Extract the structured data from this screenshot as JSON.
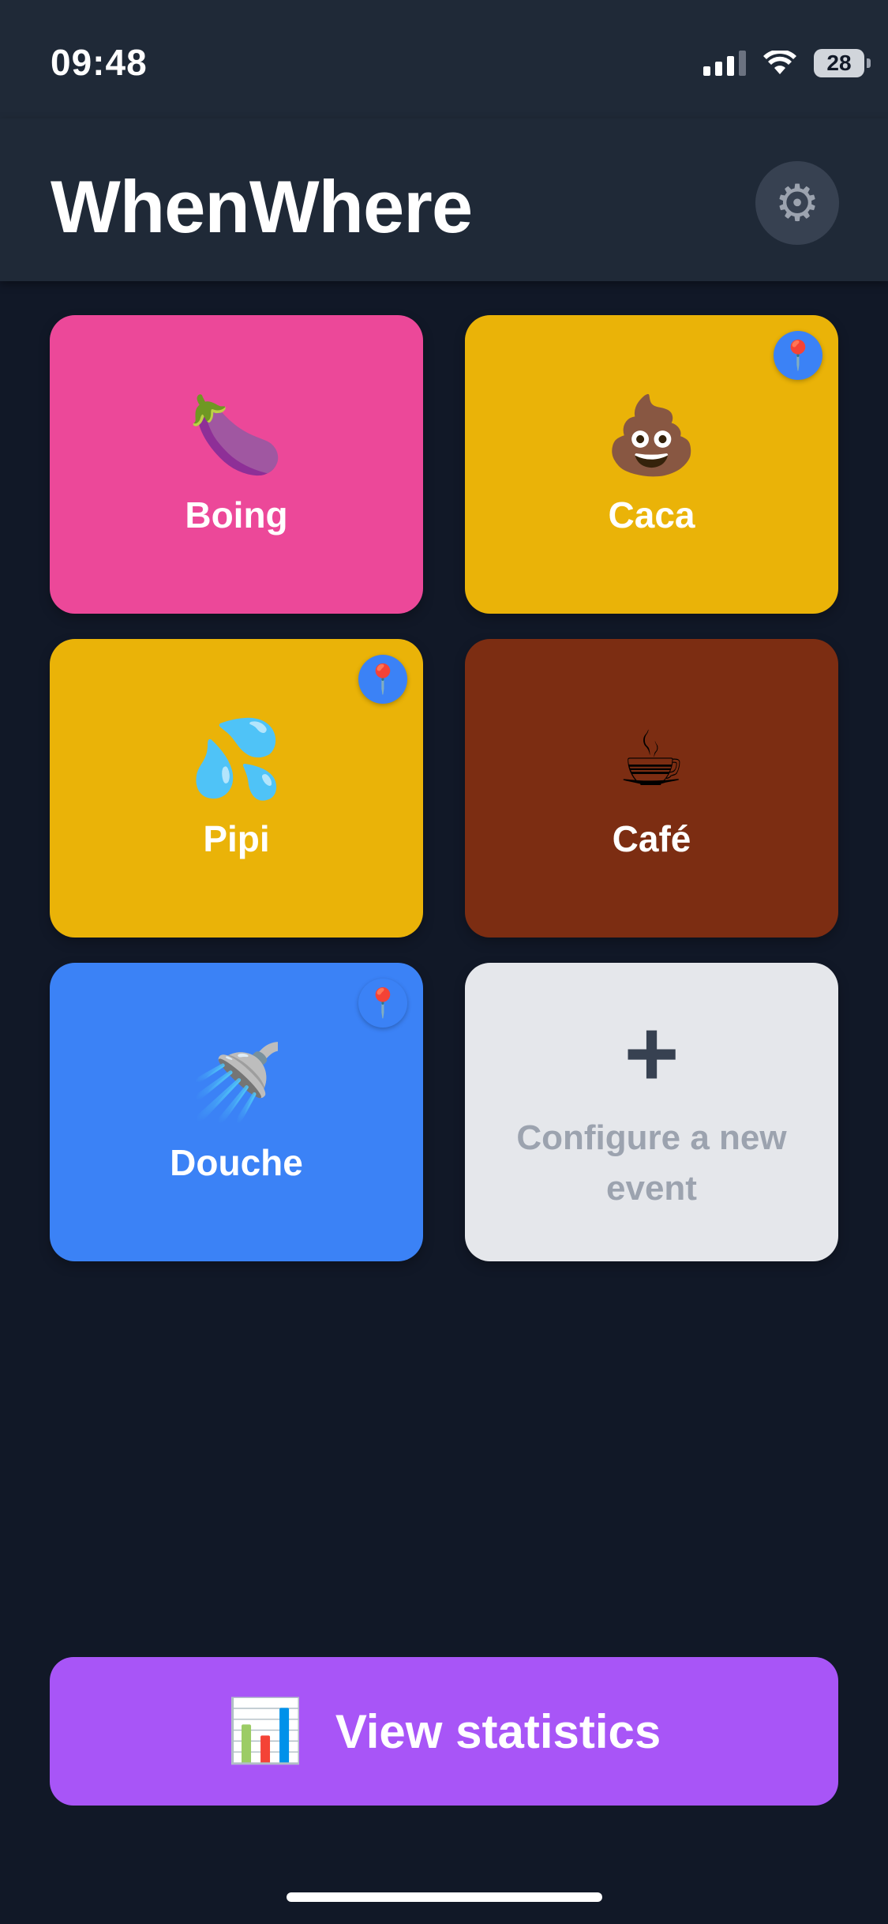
{
  "status_bar": {
    "time": "09:48",
    "battery": "28"
  },
  "header": {
    "title": "WhenWhere",
    "settings_icon": "gear-icon"
  },
  "events": [
    {
      "label": "Boing",
      "emoji": "🍆",
      "color": "#ec4899",
      "has_location": false
    },
    {
      "label": "Caca",
      "emoji": "💩",
      "color": "#eab308",
      "has_location": true
    },
    {
      "label": "Pipi",
      "emoji": "💦",
      "color": "#eab308",
      "has_location": true
    },
    {
      "label": "Café",
      "emoji": "☕",
      "color": "#7c2d12",
      "has_location": false
    },
    {
      "label": "Douche",
      "emoji": "🚿",
      "color": "#3b82f6",
      "has_location": true
    }
  ],
  "add_event": {
    "icon": "+",
    "label": "Configure a new event"
  },
  "pin_icon": "📍",
  "footer": {
    "stats_icon": "📊",
    "stats_label": "View statistics"
  }
}
